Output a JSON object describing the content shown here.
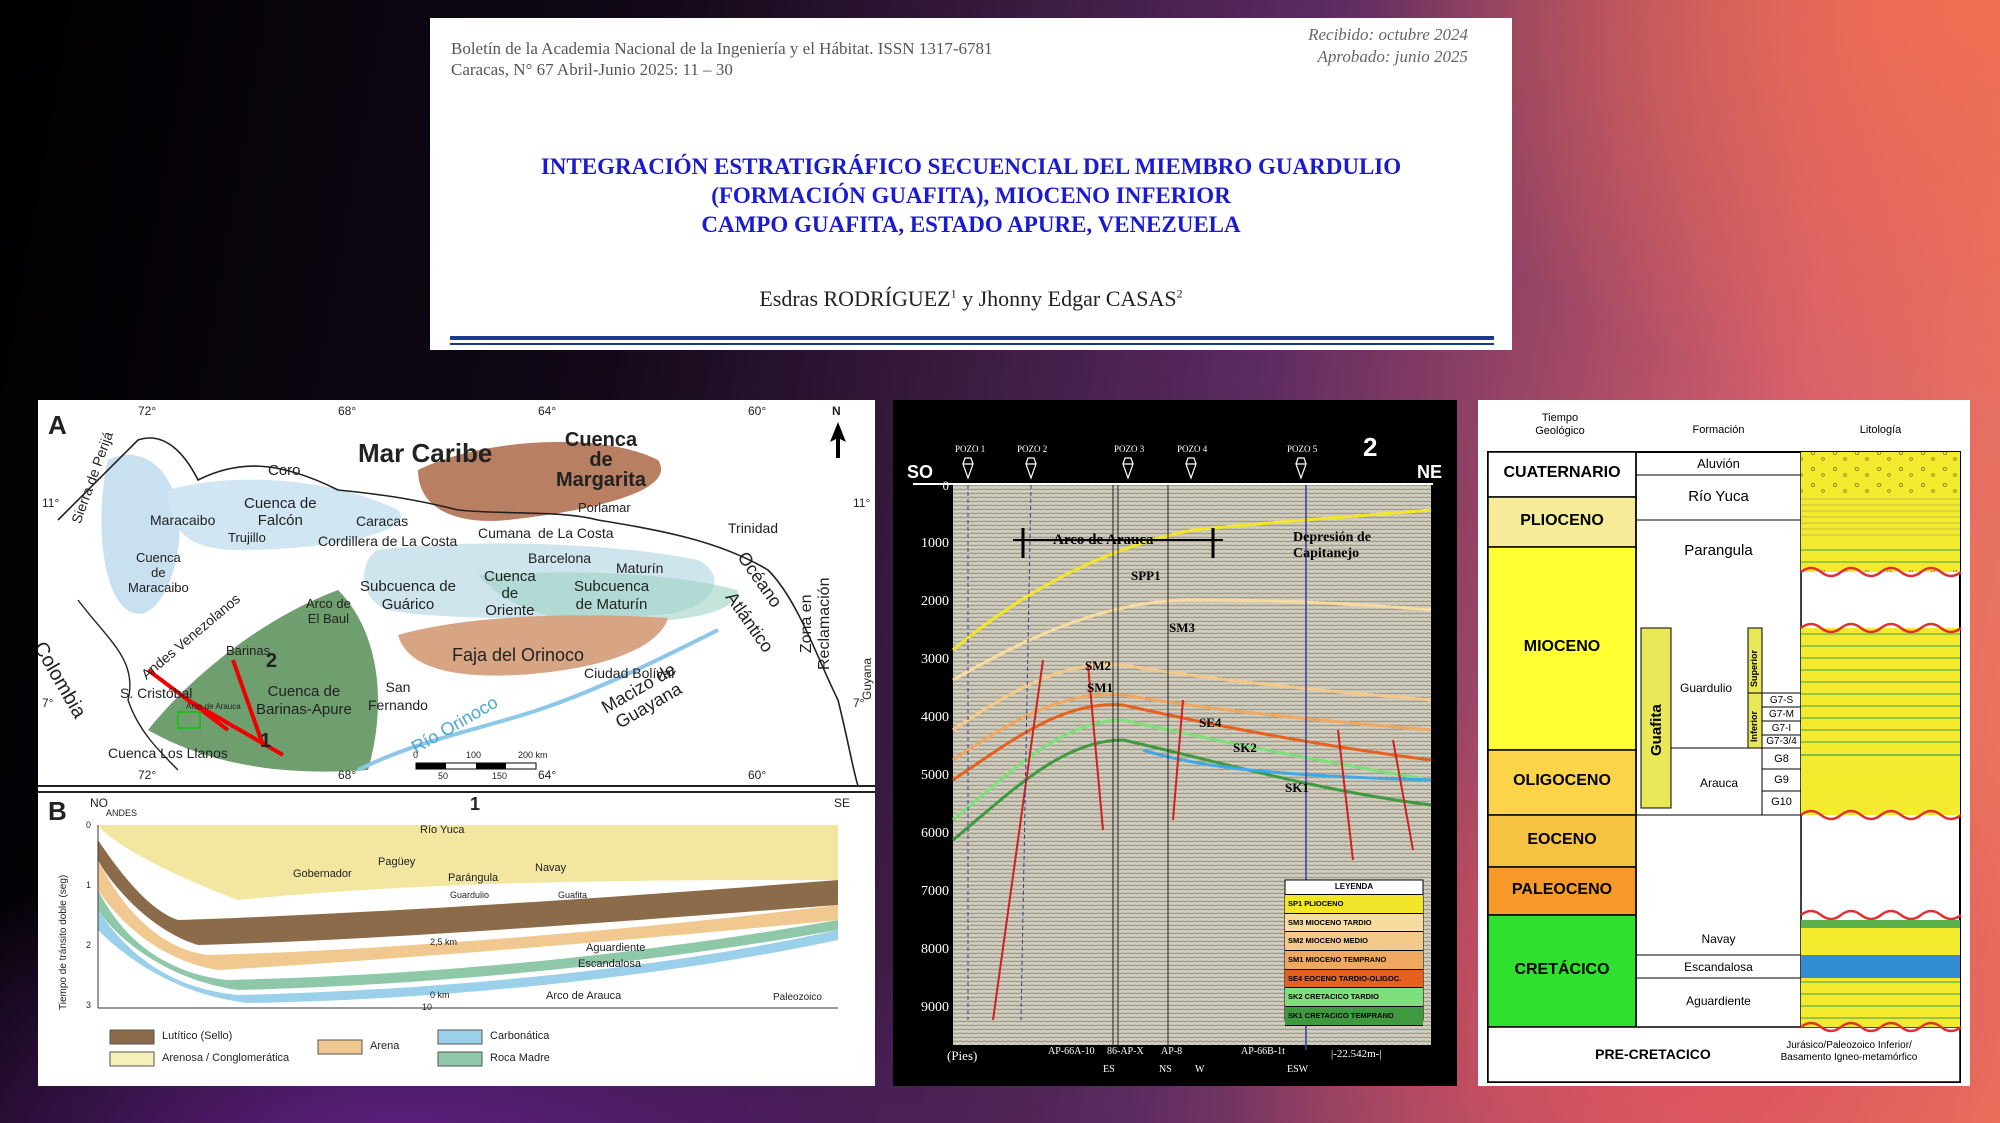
{
  "header": {
    "journal_line1": "Boletín de la Academia Nacional de la Ingeniería y el Hábitat. ISSN 1317-6781",
    "journal_line2": "Caracas, N° 67 Abril-Junio 2025: 11 – 30",
    "received": "Recibido: octubre 2024",
    "approved": "Aprobado: junio 2025",
    "title_line1": "INTEGRACIÓN ESTRATIGRÁFICO SECUENCIAL DEL MIEMBRO GUARDULIO",
    "title_line2": "(FORMACIÓN GUAFITA), MIOCENO INFERIOR",
    "title_line3": "CAMPO GUAFITA, ESTADO APURE, VENEZUELA",
    "author1": "Esdras RODRÍGUEZ",
    "author1_sup": "1",
    "author_sep": " y ",
    "author2": "Jhonny Edgar CASAS",
    "author2_sup": "2"
  },
  "map": {
    "panel_a": "A",
    "panel_b": "B",
    "north": "N",
    "lon_labels": [
      "72°",
      "68°",
      "64°",
      "60°"
    ],
    "lon_bottom": [
      "72°",
      "68°",
      "64°",
      "60°"
    ],
    "lat_labels": [
      "11°",
      "7°"
    ],
    "lat_right": [
      "11°",
      "7°"
    ],
    "places": {
      "mar_caribe": "Mar Caribe",
      "cuenca_margarita_1": "Cuenca",
      "cuenca_margarita_2": "de",
      "cuenca_margarita_3": "Margarita",
      "coro": "Coro",
      "cuenca_falcon_1": "Cuenca de",
      "cuenca_falcon_2": "Falcón",
      "maracaibo": "Maracaibo",
      "caracas": "Caracas",
      "cordillera": "Cordillera de La Costa",
      "cumana": "Cumana",
      "de_la_costa": "de La Costa",
      "porlamar": "Porlamar",
      "trinidad": "Trinidad",
      "sierra_perija": "Sierra de Perijá",
      "cuenca_maracaibo_1": "Cuenca",
      "cuenca_maracaibo_2": "de",
      "cuenca_maracaibo_3": "Maracaibo",
      "trujillo": "Trujillo",
      "barcelona": "Barcelona",
      "maturin": "Maturín",
      "oceano": "Océano",
      "atlantico": "Atlántico",
      "arco_baul_1": "Arco de",
      "arco_baul_2": "El Baul",
      "subcuenca_guarico_1": "Subcuenca de",
      "subcuenca_guarico_2": "Guárico",
      "cuenca_oriente_1": "Cuenca",
      "cuenca_oriente_2": "de",
      "cuenca_oriente_3": "Oriente",
      "subcuenca_maturin_1": "Subcuenca",
      "subcuenca_maturin_2": "de Maturín",
      "andes": "Andes Venezolanos",
      "colombia": "Colombia",
      "barinas": "Barinas",
      "faja": "Faja del Orinoco",
      "ciudad_bolivar": "Ciudad Bolívar",
      "s_cristobal": "S. Cristóbal",
      "arco_arauca": "Arco de Arauca",
      "cuenca_barinas_1": "Cuenca de",
      "cuenca_barinas_2": "Barinas-Apure",
      "san_fernando_1": "San",
      "san_fernando_2": "Fernando",
      "rio_orinoco": "Río Orinoco",
      "macizo_1": "Macizo de",
      "macizo_2": "Guayana",
      "zona_1": "Zona en",
      "zona_2": "Reclamación",
      "guyana": "Guyana",
      "cuenca_llanos": "Cuenca Los Llanos",
      "profile_1": "1",
      "profile_2": "2"
    },
    "scale": {
      "s0": "0",
      "s50": "50",
      "s100": "100",
      "s150": "150",
      "s200": "200 km"
    },
    "section": {
      "no": "NO",
      "andes": "ANDES",
      "se": "SE",
      "num": "1",
      "rio_yuca": "Río Yuca",
      "gobernador": "Gobernador",
      "paguey": "Pagüey",
      "parangula": "Parángula",
      "navay": "Navay",
      "guardulio": "Guardulio",
      "guafita": "Guafita",
      "aguardiente": "Aguardiente",
      "escandalosa": "Escandalosa",
      "arco_arauca": "Arco de Arauca",
      "paleozoico": "Paleozoico",
      "depth_25": "2,5 km",
      "depth_0": "0 km",
      "scale_10": "10",
      "y_label": "Tiempo de tránsito doble (seg)",
      "y_ticks": [
        "0",
        "1",
        "2",
        "3"
      ]
    },
    "legend": {
      "lutitico": "Lutítico (Sello)",
      "arena": "Arena",
      "carbonatica": "Carbonática",
      "arenosa": "Arenosa / Conglomerática",
      "roca_madre": "Roca Madre"
    }
  },
  "seismic": {
    "num": "2",
    "so": "SO",
    "ne": "NE",
    "wells": [
      "POZO 1",
      "POZO 2",
      "POZO 3",
      "POZO 4",
      "POZO 5"
    ],
    "depths": [
      "0",
      "1000",
      "2000",
      "3000",
      "4000",
      "5000",
      "6000",
      "7000",
      "8000",
      "9000"
    ],
    "arco": "Arco de Arauca",
    "depresion_1": "Depresión de",
    "depresion_2": "Capitanejo",
    "horizons": [
      "SPP1",
      "SM3",
      "SM2",
      "SM1",
      "SE4",
      "SK2",
      "SK1"
    ],
    "unit": "(Pies)",
    "bottom_wells": [
      "AP-66A-10",
      "86-AP-X",
      "AP-8",
      "AP-66B-1t"
    ],
    "bottom_codes": [
      "ES",
      "NS",
      "W",
      "ESW"
    ],
    "scale_label": "|-22.542m-|",
    "legend_title": "LEYENDA",
    "legend": [
      {
        "label": "SP1  PLIOCENO",
        "color": "#f2e52a"
      },
      {
        "label": "SM3 MIOCENO TARDIO",
        "color": "#f7dca0"
      },
      {
        "label": "SM2 MIOCENO MEDIO",
        "color": "#f4c98a"
      },
      {
        "label": "SM1 MIOCENO TEMPRANO",
        "color": "#f0a860"
      },
      {
        "label": "SE4 EOCENO TARDIO-OLIGOC.",
        "color": "#e8601e"
      },
      {
        "label": "SK2 CRETACICO TARDIO",
        "color": "#7ee07a"
      },
      {
        "label": "SK1 CRETACICO TEMPRANO",
        "color": "#3f9a3f"
      }
    ]
  },
  "column": {
    "head_time_1": "Tiempo",
    "head_time_2": "Geológico",
    "head_formation": "Formación",
    "head_litho": "Litología",
    "eras": {
      "cuaternario": "CUATERNARIO",
      "plioceno": "PLIOCENO",
      "mioceno": "MIOCENO",
      "oligoceno": "OLIGOCENO",
      "eoceno": "EOCENO",
      "paleoceno": "PALEOCENO",
      "cretacico": "CRETÁCICO",
      "precretacico": "PRE-CRETACICO"
    },
    "formations": {
      "aluvion": "Aluvión",
      "rio_yuca": "Río Yuca",
      "parangula": "Parangula",
      "guafita": "Guafita",
      "guardulio": "Guardulio",
      "superior": "Superior",
      "inferior": "Inferior",
      "g7s": "G7-S",
      "g7m": "G7-M",
      "g7i": "G7-I",
      "g734": "G7-3/4",
      "arauca": "Arauca",
      "g8": "G8",
      "g9": "G9",
      "g10": "G10",
      "navay": "Navay",
      "escandalosa": "Escandalosa",
      "aguardiente": "Aguardiente",
      "basement_1": "Jurásico/Paleozoico Inferior/",
      "basement_2": "Basamento Igneo-metamórfico"
    },
    "colors": {
      "cuaternario": "#ffffff",
      "plioceno": "#f7ec9a",
      "mioceno": "#ffff33",
      "oligoceno": "#fcd44a",
      "eoceno": "#f5c242",
      "paleoceno": "#f79a2a",
      "cretacico": "#2fe02f",
      "litho_yellow": "#f4ea2e"
    }
  }
}
